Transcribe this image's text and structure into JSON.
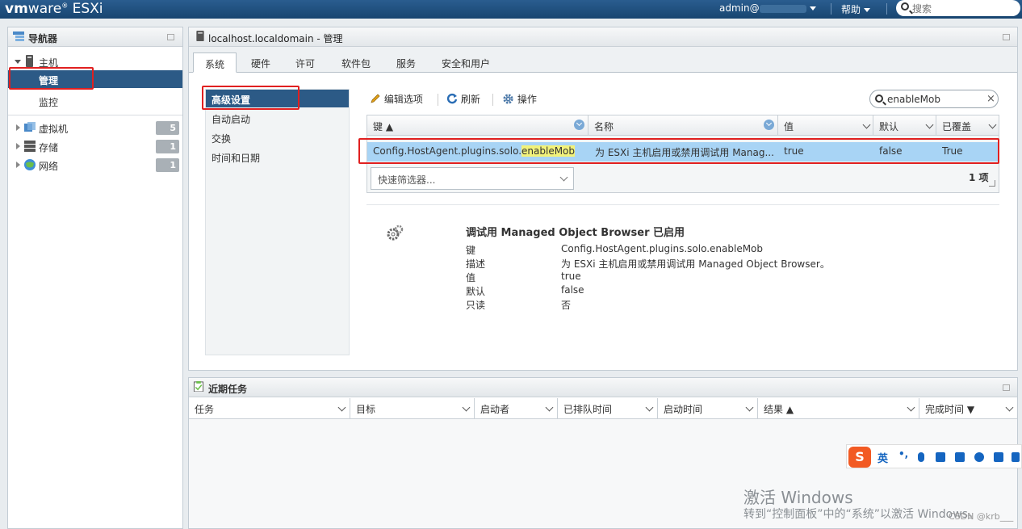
{
  "topbar": {
    "logo_vm": "vm",
    "logo_ware": "ware",
    "logo_product": "ESXi",
    "user": "admin@",
    "help": "帮助",
    "search_placeholder": "搜索"
  },
  "navigator": {
    "title": "导航器",
    "host_label": "主机",
    "manage_label": "管理",
    "monitor_label": "监控",
    "items": [
      {
        "label": "虚拟机",
        "count": "5",
        "icon": "vm-icon"
      },
      {
        "label": "存储",
        "count": "1",
        "icon": "storage-icon"
      },
      {
        "label": "网络",
        "count": "1",
        "icon": "network-icon"
      }
    ]
  },
  "main": {
    "title": "localhost.localdomain - 管理",
    "tabs": [
      "系统",
      "硬件",
      "许可",
      "软件包",
      "服务",
      "安全和用户"
    ],
    "active_tab": "系统",
    "sidebar": [
      "高级设置",
      "自动启动",
      "交换",
      "时间和日期"
    ],
    "toolbar": {
      "edit": "编辑选项",
      "refresh": "刷新",
      "actions": "操作"
    },
    "filter_value": "enableMob",
    "grid": {
      "columns": [
        "键 ▲",
        "名称",
        "值",
        "默认",
        "已覆盖"
      ],
      "row": {
        "key_prefix": "Config.HostAgent.plugins.solo.",
        "key_highlight": "enableMob",
        "name": "为 ESXi 主机启用或禁用调试用 Manag...",
        "value": "true",
        "default": "false",
        "overridden": "True"
      },
      "quick_filter": "快速筛选器...",
      "count": "1 项"
    },
    "detail": {
      "title": "调试用 Managed Object Browser 已启用",
      "rows": [
        {
          "k": "键",
          "v": "Config.HostAgent.plugins.solo.enableMob"
        },
        {
          "k": "描述",
          "v": "为 ESXi 主机启用或禁用调试用 Managed Object Browser。"
        },
        {
          "k": "值",
          "v": "true"
        },
        {
          "k": "默认",
          "v": "false"
        },
        {
          "k": "只读",
          "v": "否"
        }
      ]
    }
  },
  "tasks": {
    "title": "近期任务",
    "columns": [
      "任务",
      "目标",
      "启动者",
      "已排队时间",
      "启动时间",
      "结果 ▲",
      "完成时间 ▼"
    ]
  },
  "ime": {
    "lang": "英"
  },
  "watermark": {
    "line1": "激活 Windows",
    "line2": "转到“控制面板”中的“系统”以激活 Windows。"
  },
  "credit": "CSDN @krb___"
}
